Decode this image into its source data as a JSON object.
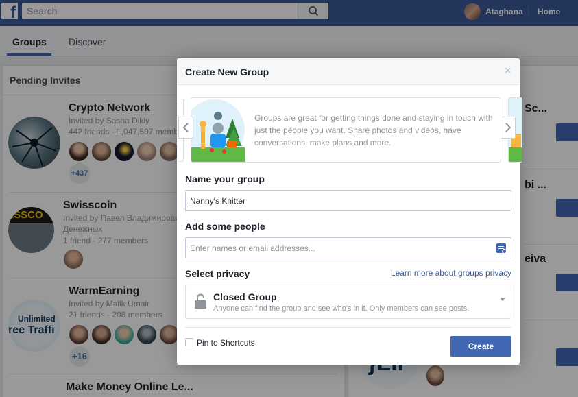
{
  "topbar": {
    "logo_letter": "f",
    "search_placeholder": "Search",
    "user_name": "Ataghana",
    "home_label": "Home"
  },
  "tabs": [
    {
      "label": "Groups",
      "active": true
    },
    {
      "label": "Discover",
      "active": false
    }
  ],
  "pending": {
    "title": "Pending Invites",
    "invites": [
      {
        "name": "Crypto Network",
        "invited_by": "Invited by Sasha Dikiy",
        "stats": "442 friends · 1,047,597 members",
        "more": "+437"
      },
      {
        "name": "Swisscoin",
        "invited_by": "Invited by Павел Владимирович",
        "invited_by_2": "Денежных",
        "stats": "1 friend · 277 members",
        "logo_text": "ISSCO"
      },
      {
        "name": "WarmEarning",
        "invited_by": "Invited by Malik Umair",
        "stats": "21 friends · 208 members",
        "more": "+16",
        "logo_line1": "Unlimited",
        "logo_line2": "ree Traffi"
      },
      {
        "name": "Make Money Online Le..."
      }
    ]
  },
  "right_panel": {
    "names": [
      "Sc...",
      "bi ...",
      "eiva"
    ],
    "logo_text": "}Lir"
  },
  "modal": {
    "title": "Create New Group",
    "close_symbol": "×",
    "carousel_text": "Groups are great for getting things done and staying in touch with just the people you want. Share photos and videos, have conversations, make plans and more.",
    "name_label": "Name your group",
    "name_value": "Nanny's Knitter",
    "people_label": "Add some people",
    "people_placeholder": "Enter names or email addresses...",
    "privacy_label": "Select privacy",
    "privacy_link": "Learn more about groups privacy",
    "privacy_option": "Closed Group",
    "privacy_desc": "Anyone can find the group and see who's in it. Only members can see posts.",
    "pin_label": "Pin to Shortcuts",
    "pin_checked": false,
    "create_label": "Create"
  },
  "colors": {
    "brand_blue": "#3b5998",
    "button_blue": "#4267b2",
    "link_blue": "#365899"
  },
  "icons": [
    "facebook-logo",
    "search-icon",
    "close-icon",
    "chevron-left-icon",
    "chevron-right-icon",
    "add-people-icon",
    "lock-icon",
    "dropdown-caret-icon"
  ]
}
